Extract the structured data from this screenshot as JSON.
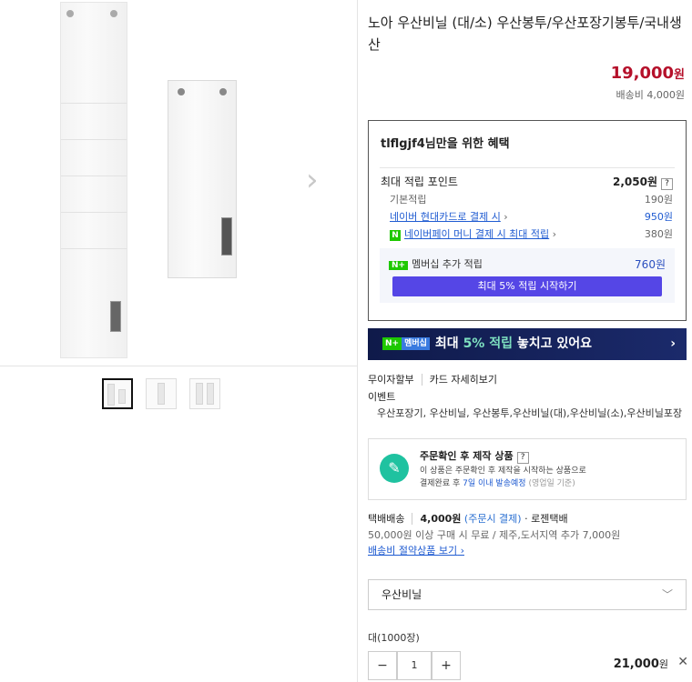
{
  "product": {
    "title": "노아 우산비닐 (대/소) 우산봉투/우산포장기봉투/국내생산",
    "price_number": "19,000",
    "price_unit": "원",
    "shipping_fee": "배송비 4,000원"
  },
  "benefit": {
    "header": "tlflgjf4님만을 위한 혜택",
    "max_points_label": "최대 적립 포인트",
    "max_points_value": "2,050원",
    "basic_label": "기본적립",
    "basic_value": "190원",
    "card_label": "네이버 현대카드로 결제 시",
    "card_value": "950원",
    "npay_label": "네이버페이 머니 결제 시 최대 적립",
    "npay_value": "380원",
    "membership_label": "멤버십 추가 적립",
    "membership_value": "760원",
    "membership_button": "최대 5% 적립 시작하기",
    "npay_badge": "N",
    "n_plus_badge": "N+"
  },
  "banner": {
    "badge": "N+",
    "badge2": "멤버십",
    "text_prefix": "최대",
    "text_highlight": "5% 적립",
    "text_suffix": "놓치고 있어요"
  },
  "links": {
    "installment": "무이자할부",
    "card_detail": "카드 자세히보기",
    "event_label": "이벤트",
    "event_tags": "우산포장기, 우산비닐, 우산봉투,우산비닐(대),우산비닐(소),우산비닐포장"
  },
  "made_to_order": {
    "title": "주문확인 후 제작 상품",
    "desc_1": "이 상품은 주문확인 후 제작을 시작하는 상품으로",
    "desc_2_prefix": "결제완료 후",
    "desc_2_highlight": "7일 이내 발송예정",
    "desc_2_suffix": "(영업일 기준)"
  },
  "delivery": {
    "label": "택배배송",
    "fee": "4,000원",
    "fee_note": "(주문시 결제)",
    "carrier": "· 로젠택배",
    "free_info": "50,000원 이상 구매 시 무료 / 제주,도서지역 추가 7,000원",
    "saving_link": "배송비 절약상품 보기"
  },
  "option": {
    "selected": "우산비닐",
    "item_name": "대(1000장)",
    "quantity": "1",
    "minus": "−",
    "plus": "+",
    "item_price_number": "21,000",
    "item_price_unit": "원"
  },
  "gallery": {
    "thumbnails": 3
  }
}
